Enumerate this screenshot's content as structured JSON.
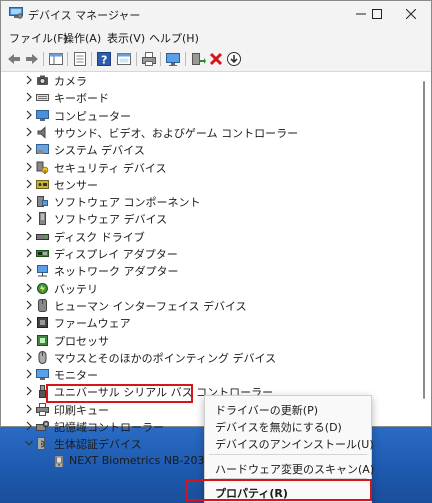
{
  "window": {
    "title": "デバイス マネージャー",
    "controls": [
      "minimize",
      "maximize",
      "close"
    ]
  },
  "menu": {
    "file": "ファイル(F)",
    "action": "操作(A)",
    "view": "表示(V)",
    "help": "ヘルプ(H)"
  },
  "toolbar": {
    "icons": [
      "back-icon",
      "forward-icon",
      "show-hide-console-tree-icon",
      "properties-icon",
      "help-icon",
      "view-icon",
      "print-icon",
      "monitor-icon",
      "update-driver-icon",
      "uninstall-icon",
      "download-icon"
    ],
    "colors": {
      "uninstall": "#d8141b",
      "update": "#2a8a2a"
    }
  },
  "tree": {
    "categories": [
      {
        "label": "カメラ",
        "icon": "camera-icon"
      },
      {
        "label": "キーボード",
        "icon": "keyboard-icon"
      },
      {
        "label": "コンピューター",
        "icon": "computer-icon"
      },
      {
        "label": "サウンド、ビデオ、およびゲーム コントローラー",
        "icon": "speaker-icon"
      },
      {
        "label": "システム デバイス",
        "icon": "system-device-icon"
      },
      {
        "label": "セキュリティ デバイス",
        "icon": "security-device-icon"
      },
      {
        "label": "センサー",
        "icon": "sensor-icon"
      },
      {
        "label": "ソフトウェア コンポーネント",
        "icon": "software-component-icon"
      },
      {
        "label": "ソフトウェア デバイス",
        "icon": "software-device-icon"
      },
      {
        "label": "ディスク ドライブ",
        "icon": "disk-drive-icon"
      },
      {
        "label": "ディスプレイ アダプター",
        "icon": "display-adapter-icon"
      },
      {
        "label": "ネットワーク アダプター",
        "icon": "network-adapter-icon"
      },
      {
        "label": "バッテリ",
        "icon": "battery-icon"
      },
      {
        "label": "ヒューマン インターフェイス デバイス",
        "icon": "hid-icon"
      },
      {
        "label": "ファームウェア",
        "icon": "firmware-icon"
      },
      {
        "label": "プロセッサ",
        "icon": "processor-icon"
      },
      {
        "label": "マウスとそのほかのポインティング デバイス",
        "icon": "mouse-icon"
      },
      {
        "label": "モニター",
        "icon": "monitor-icon"
      },
      {
        "label": "ユニバーサル シリアル バス コントローラー",
        "icon": "usb-icon"
      },
      {
        "label": "印刷キュー",
        "icon": "print-queue-icon"
      },
      {
        "label": "記憶域コントローラー",
        "icon": "storage-controller-icon"
      },
      {
        "label": "生体認証デバイス",
        "icon": "biometric-icon",
        "expanded": true
      }
    ],
    "selected_device": {
      "label": "NEXT Biometrics NB-2033-U",
      "icon": "fingerprint-device-icon"
    }
  },
  "context_menu": {
    "items": [
      "ドライバーの更新(P)",
      "デバイスを無効にする(D)",
      "デバイスのアンインストール(U)",
      "ハードウェア変更のスキャン(A)",
      "プロパティ(R)"
    ]
  },
  "highlight_color": "#d8141b"
}
